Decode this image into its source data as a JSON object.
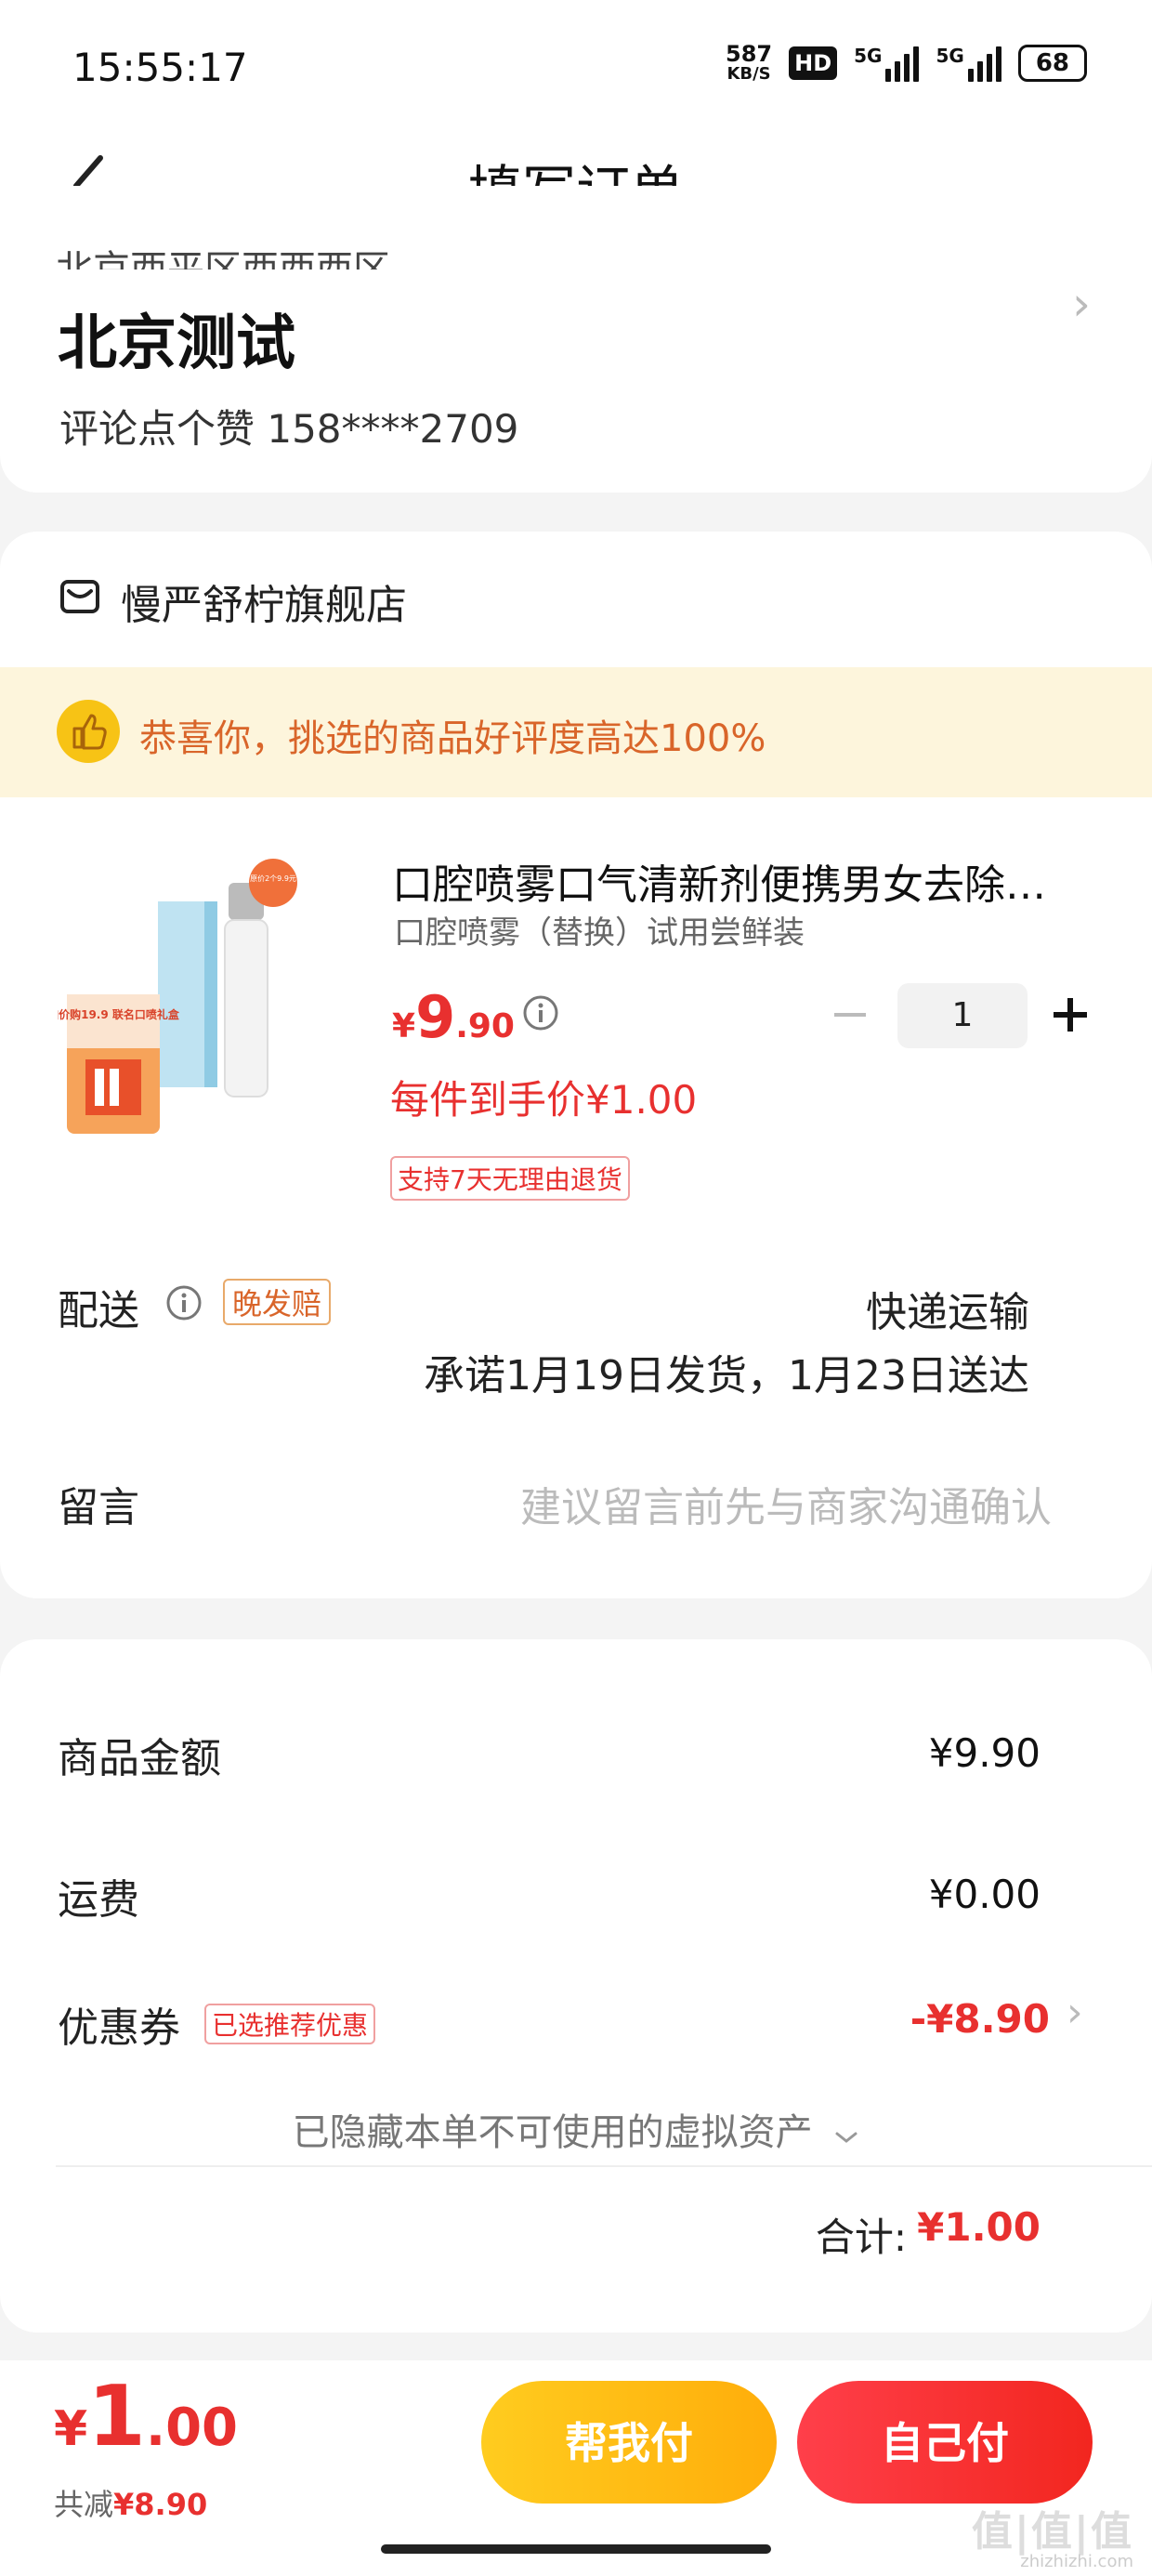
{
  "status_bar": {
    "time": "15:55:17",
    "net_speed": "587",
    "net_unit": "KB/S",
    "hd": "HD",
    "sig1": "5G",
    "sig2": "5G",
    "battery": "68"
  },
  "header": {
    "title": "填写订单"
  },
  "address": {
    "clipped_line": "北京西平区西西西区",
    "name": "北京测试",
    "contact": "评论点个赞  158****2709"
  },
  "shop": {
    "name": "慢严舒柠旗舰店"
  },
  "banner": {
    "text": "恭喜你，挑选的商品好评度高达100%"
  },
  "product": {
    "title": "口腔喷雾口气清新剂便携男女去除…",
    "spec": "口腔喷雾（替换）试用尝鲜装",
    "currency": "¥",
    "price_int": "9",
    "price_dec": ".90",
    "quantity": "1",
    "unit_price": "每件到手价¥1.00",
    "return_policy": "支持7天无理由退货",
    "image_badge": "加价购19.9 联名口喷礼盒",
    "image_corner": "原价2个9.9元"
  },
  "delivery": {
    "label": "配送",
    "late_tag": "晚发赔",
    "method": "快递运输",
    "promise": "承诺1月19日发货，1月23日送达"
  },
  "message": {
    "label": "留言",
    "placeholder": "建议留言前先与商家沟通确认"
  },
  "summary": {
    "goods_label": "商品金额",
    "goods_value": "¥9.90",
    "freight_label": "运费",
    "freight_value": "¥0.00",
    "coupon_label": "优惠券",
    "coupon_tag": "已选推荐优惠",
    "coupon_value": "-¥8.90",
    "hidden_assets": "已隐藏本单不可使用的虚拟资产",
    "total_label": "合计:",
    "total_value": "¥1.00"
  },
  "bottom": {
    "currency": "¥",
    "price_int": "1",
    "price_dec": ".00",
    "save_label": "共减",
    "save_value": "¥8.90",
    "help_pay": "帮我付",
    "self_pay": "自己付"
  },
  "watermark": {
    "text": "值|值|值",
    "sub": "zhizhizhi.com"
  },
  "colors": {
    "accent_red": "#e8302f",
    "accent_yellow": "#ffcc1f",
    "banner_bg": "#fdf5dc",
    "banner_text": "#d9652a"
  }
}
